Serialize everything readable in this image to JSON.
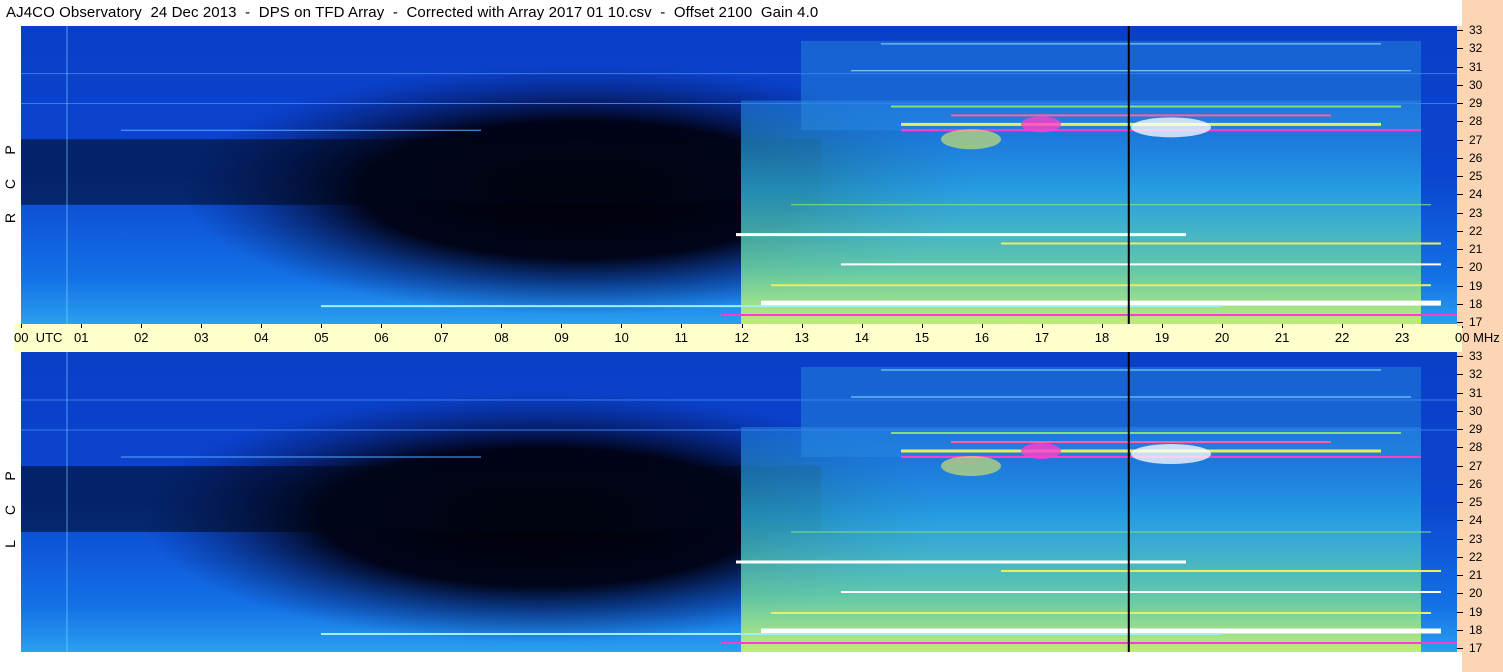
{
  "title": "AJ4CO Observatory  24 Dec 2013  -  DPS on TFD Array  -  Corrected with Array 2017 01 10.csv  -  Offset 2100  Gain 4.0",
  "panels": {
    "top": {
      "polarization": [
        "R",
        "C",
        "P"
      ]
    },
    "bottom": {
      "polarization": [
        "L",
        "C",
        "P"
      ]
    }
  },
  "time_axis": {
    "ticks": [
      "00  UTC",
      "01",
      "02",
      "03",
      "04",
      "05",
      "06",
      "07",
      "08",
      "09",
      "10",
      "11",
      "12",
      "13",
      "14",
      "15",
      "16",
      "17",
      "18",
      "19",
      "20",
      "21",
      "22",
      "23",
      "00 MHz"
    ]
  },
  "freq_axis": {
    "ticks": [
      "33",
      "32",
      "31",
      "30",
      "29",
      "28",
      "27",
      "26",
      "25",
      "24",
      "23",
      "22",
      "21",
      "20",
      "19",
      "18",
      "17"
    ]
  },
  "colors": {
    "background_blue": "#0a3fc8",
    "dark_region": "#000510",
    "active_cyan": "#2fb8e8",
    "active_green": "#7fe080",
    "active_yellow": "#e8ee60",
    "active_magenta": "#ff3cd0",
    "axis_strip": "#fcd6b4",
    "time_axis_strip": "#ffffcc",
    "marker_line": "#000000"
  },
  "marker_time_utc": 18.45
}
